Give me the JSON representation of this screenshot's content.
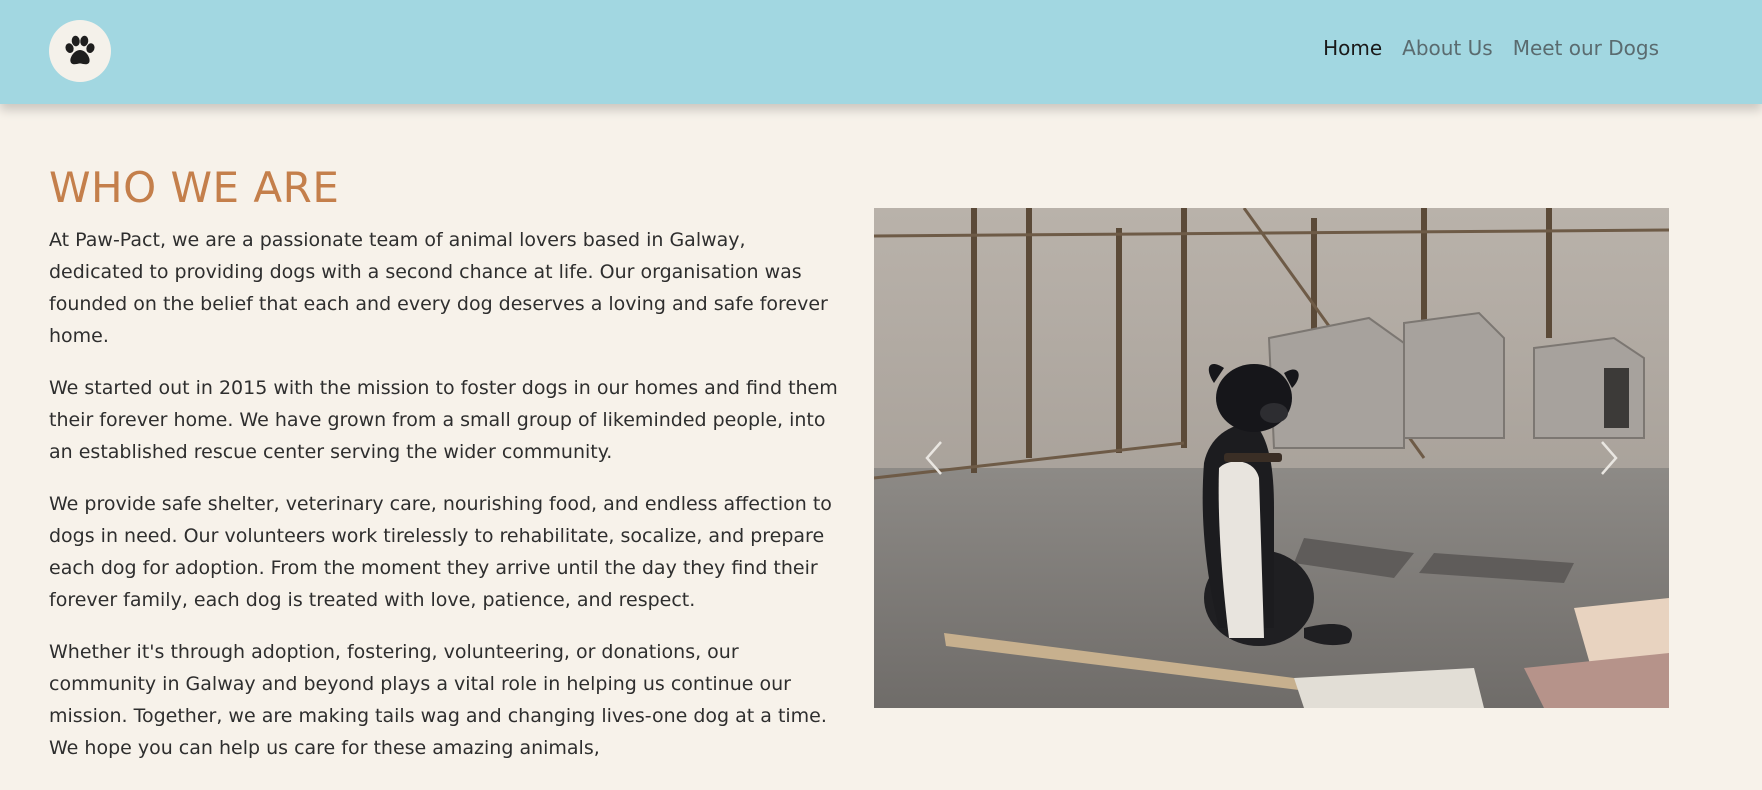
{
  "brand": {
    "logo_icon": "paw-icon",
    "colors": {
      "navbar": "#a2d7e1",
      "accent": "#c47f4b",
      "background": "#f7f2ea"
    }
  },
  "nav": {
    "items": [
      {
        "label": "Home",
        "active": true
      },
      {
        "label": "About Us",
        "active": false
      },
      {
        "label": "Meet our Dogs",
        "active": false
      }
    ]
  },
  "about": {
    "title": "WHO WE ARE",
    "paragraphs": [
      "At Paw-Pact, we are a passionate team of animal lovers based in Galway, dedicated to providing dogs with a second chance at life. Our organisation was founded on the belief that each and every dog deserves a loving and safe forever home.",
      "We started out in 2015 with the mission to foster dogs in our homes and find them their forever home. We have grown from a small group of likeminded people, into an established rescue center serving the wider community.",
      "We provide safe shelter, veterinary care, nourishing food, and endless affection to dogs in need. Our volunteers work tirelessly to rehabilitate, socalize, and prepare each dog for adoption. From the moment they arrive until the day they find their forever family, each dog is treated with love, patience, and respect.",
      "Whether it's through adoption, fostering, volunteering, or donations, our community in Galway and beyond plays a vital role in helping us continue our mission. Together, we are making tails wag and changing lives-one dog at a time. We hope you can help us care for these amazing animals,"
    ]
  },
  "carousel": {
    "prev_icon": "chevron-left-icon",
    "next_icon": "chevron-right-icon"
  }
}
